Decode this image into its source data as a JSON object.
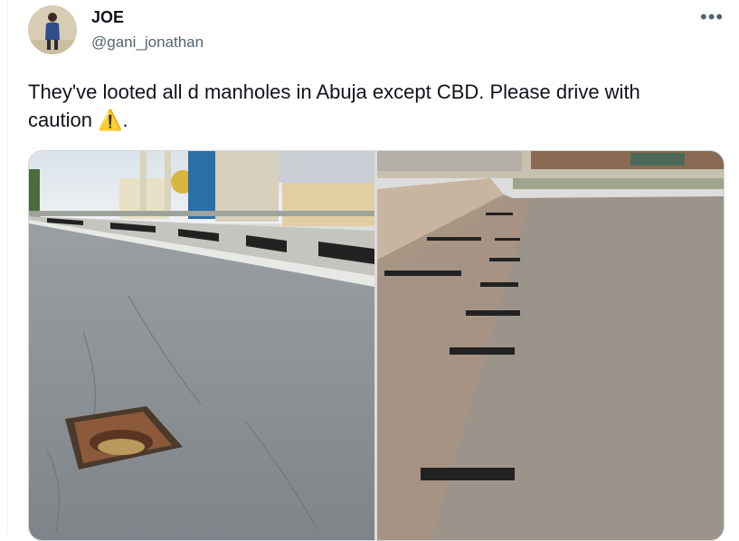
{
  "tweet": {
    "display_name": "JOE",
    "handle": "@gani_jonathan",
    "more_label": "•••",
    "text": "They've looted all d manholes in Abuja except CBD. Please drive with caution",
    "warning_glyph": "⚠️",
    "text_end": "."
  },
  "media": {
    "items": [
      {
        "name": "photo-road-manhole"
      },
      {
        "name": "photo-bridge-drain-openings"
      }
    ]
  },
  "icons": {
    "more": "more-horizontal-icon",
    "warning": "warning-icon"
  },
  "colors": {
    "text": "#0f1419",
    "secondary": "#536471",
    "border": "#cfd9de"
  }
}
